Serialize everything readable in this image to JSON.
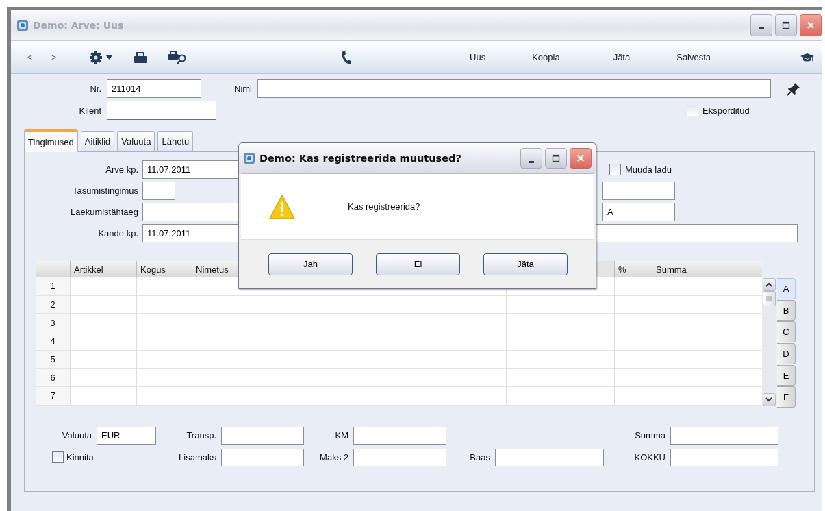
{
  "window": {
    "title": "Demo: Arve: Uus"
  },
  "toolbar": {
    "nav": [
      "<",
      ">"
    ],
    "actions": [
      "Uus",
      "Koopia",
      "Jäta",
      "Salvesta"
    ]
  },
  "header": {
    "nr": {
      "label": "Nr.",
      "value": "211014"
    },
    "nimi": {
      "label": "Nimi"
    },
    "klient": {
      "label": "Klient",
      "focused": true
    },
    "exported": {
      "label": "Eksporditud",
      "checked": false
    }
  },
  "tabs": [
    {
      "label": "Tingimused",
      "selected": true
    },
    {
      "label": "Aitiklid",
      "selected": false
    },
    {
      "label": "Valuuta",
      "selected": false
    },
    {
      "label": "Lähetu",
      "selected": false
    }
  ],
  "terms": {
    "fields": [
      {
        "label": "Arve kp.",
        "value": "11.07.2011",
        "kind": "long"
      },
      {
        "label": "Tasumistingimus",
        "kind": "short"
      },
      {
        "label": "Laekumistähtaeg",
        "kind": "long"
      },
      {
        "label": "Kande kp.",
        "value": "11.07.2011",
        "kind": "long"
      }
    ],
    "side": [
      {
        "kind": "checkbox",
        "label": "Muuda ladu",
        "checked": false
      },
      {
        "kind": "short"
      },
      {
        "kind": "short",
        "value": "A"
      },
      {
        "kind": "long"
      }
    ]
  },
  "grid": {
    "columns": [
      {
        "label": "Artikkel"
      },
      {
        "label": "Kogus"
      },
      {
        "label": "Nimetus"
      },
      {
        "kind": "hidden"
      },
      {
        "label": "%"
      },
      {
        "label": "Summa"
      }
    ],
    "rows": [
      "1",
      "2",
      "3",
      "4",
      "5",
      "6",
      "7"
    ],
    "pages": [
      {
        "label": "A",
        "selected": true
      },
      {
        "label": "B",
        "selected": false
      },
      {
        "label": "C",
        "selected": false
      },
      {
        "label": "D",
        "selected": false
      },
      {
        "label": "E",
        "selected": false
      },
      {
        "label": "F",
        "selected": false
      }
    ]
  },
  "totals": [
    [
      {
        "kind": "field",
        "label": "Valuuta",
        "value": "EUR"
      },
      {
        "kind": "checkbox",
        "label": "Kinnita",
        "checked": false
      }
    ],
    [
      {
        "kind": "field",
        "label": "Transp."
      },
      {
        "kind": "field",
        "label": "Lisamaks"
      }
    ],
    [
      {
        "kind": "field",
        "label": "KM"
      },
      {
        "kind": "field",
        "label": "Maks 2"
      }
    ],
    [
      {
        "kind": "field",
        "label": "Baas"
      }
    ],
    [
      {
        "kind": "field",
        "label": "Summa"
      },
      {
        "kind": "field",
        "label": "KOKKU"
      }
    ]
  ],
  "dialog": {
    "title": "Demo: Kas registreerida muutused?",
    "message": "Kas registreerida?",
    "buttons": [
      "Jah",
      "Ei",
      "Jäta"
    ]
  }
}
